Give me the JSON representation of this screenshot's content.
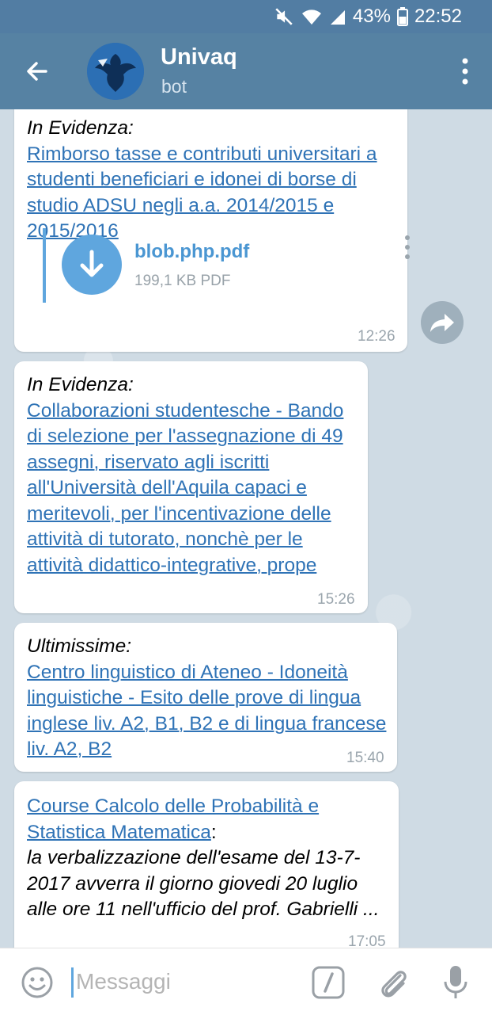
{
  "status": {
    "battery_percent": "43%",
    "time": "22:52"
  },
  "header": {
    "title": "Univaq",
    "subtitle": "bot",
    "avatar": "univaq-eagle-logo"
  },
  "messages": [
    {
      "label": "In Evidenza:",
      "link": "Rimborso tasse e contributi universitari a studenti beneficiari e idonei di borse di studio ADSU negli a.a. 2014/2015 e 2015/2016",
      "file": {
        "name": "blob.php.pdf",
        "size": "199,1 KB PDF"
      },
      "time": "12:26"
    },
    {
      "label": "In Evidenza:",
      "link": "Collaborazioni studentesche - Bando di selezione per l'assegnazione di 49 assegni, riservato agli iscritti all'Università dell'Aquila capaci e meritevoli, per l'incentivazione delle attività di tutorato, nonchè per le attività didattico-integrative, prope",
      "time": "15:26"
    },
    {
      "label": "Ultimissime:",
      "link": "Centro linguistico di Ateneo - Idoneità linguistiche - Esito delle prove di lingua inglese liv. A2, B1, B2 e di lingua francese liv. A2, B2",
      "time": "15:40"
    },
    {
      "link": "Course Calcolo delle Probabilità e Statistica Matematica",
      "after_link": ":",
      "body": "la verbalizzazione dell'esame del 13-7-2017 avverra il giorno giovedi 20 luglio alle ore 11 nell'ufficio del prof. Gabrielli ...",
      "time": "17:05"
    }
  ],
  "input": {
    "placeholder": "Messaggi"
  },
  "icons": {
    "back": "arrow-left-icon",
    "menu": "more-vertical-icon",
    "download": "download-icon",
    "forward": "forward-icon",
    "emoji": "emoji-icon",
    "bot_command": "slash-command-icon",
    "attach": "paperclip-icon",
    "mic": "microphone-icon",
    "mute": "mute-icon",
    "wifi": "wifi-icon",
    "signal": "signal-icon",
    "battery": "battery-icon"
  },
  "colors": {
    "header": "#5682a3",
    "statusbar": "#527da3",
    "link": "#2f73b6",
    "accent": "#5fa6de"
  }
}
